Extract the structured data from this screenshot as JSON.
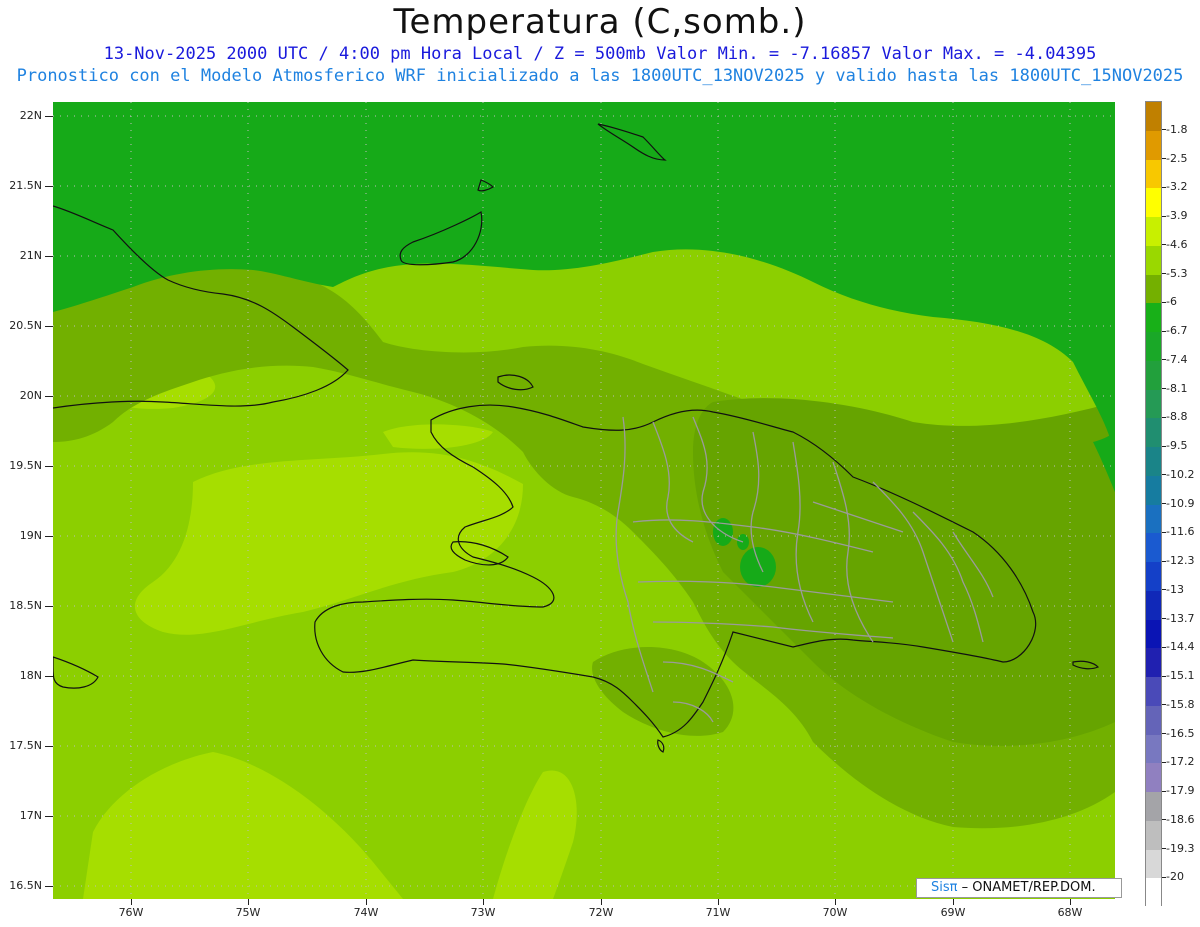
{
  "header": {
    "title": "Temperatura (C,somb.)",
    "line1": "13-Nov-2025  2000 UTC / 4:00 pm Hora Local / Z = 500mb  Valor Min. = -7.16857  Valor Max. = -4.04395",
    "line2": "Pronostico con el Modelo Atmosferico WRF inicializado a las 1800UTC_13NOV2025 y valido hasta las  1800UTC_15NOV2025"
  },
  "axes": {
    "y_labels": [
      "22N",
      "21.5N",
      "21N",
      "20.5N",
      "20N",
      "19.5N",
      "19N",
      "18.5N",
      "18N",
      "17.5N",
      "17N",
      "16.5N"
    ],
    "x_labels": [
      "76W",
      "75W",
      "74W",
      "73W",
      "72W",
      "71W",
      "70W",
      "69W",
      "68W"
    ]
  },
  "legend": {
    "labels": [
      "-1.8",
      "-2.5",
      "-3.2",
      "-3.9",
      "-4.6",
      "-5.3",
      "-6",
      "-6.7",
      "-7.4",
      "-8.1",
      "-8.8",
      "-9.5",
      "-10.2",
      "-10.9",
      "-11.6",
      "-12.3",
      "-13",
      "-13.7",
      "-14.4",
      "-15.1",
      "-15.8",
      "-16.5",
      "-17.2",
      "-17.9",
      "-18.6",
      "-19.3",
      "-20"
    ],
    "colors": [
      "#c08000",
      "#e09a00",
      "#f8c800",
      "#ffff00",
      "#c8f000",
      "#9ad800",
      "#74b000",
      "#18b018",
      "#1aa828",
      "#22a03c",
      "#259a55",
      "#208e70",
      "#1a8488",
      "#167ca0",
      "#1a70c0",
      "#1a5ad0",
      "#1440c8",
      "#1028b8",
      "#0a14b4",
      "#2020b0",
      "#4a4ab8",
      "#6464b8",
      "#7878c0",
      "#9080c0",
      "#a4a4a8",
      "#bebebe",
      "#d8d8d8",
      "#ffffff"
    ]
  },
  "field_colors": {
    "band_5": "#a8e000",
    "band_4_6": "#88d000",
    "band_5_3": "#74b200",
    "band_6": "#68a600",
    "band_6_7": "#18ac18"
  },
  "credit": {
    "sis": "Sisπ",
    "rest": "– ONAMET/REP.DOM."
  }
}
